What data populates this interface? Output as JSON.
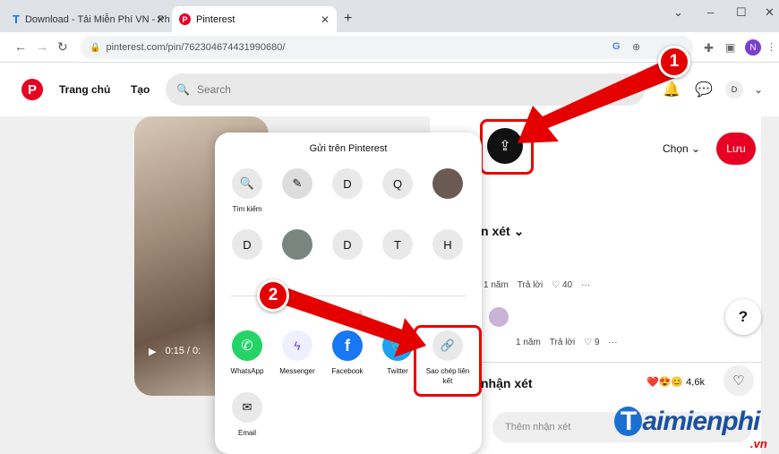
{
  "browser": {
    "tabs": [
      {
        "label": "Download - Tải Miễn Phí VN - Ph"
      },
      {
        "label": "Pinterest"
      }
    ],
    "url": "pinterest.com/pin/762304674431990680/",
    "profile_initial": "N"
  },
  "header": {
    "nav_home": "Trang chủ",
    "nav_create": "Tạo",
    "search_placeholder": "Search",
    "avatar": "D"
  },
  "pin": {
    "video_time": "0:15 / 0:"
  },
  "panel": {
    "select_label": "Chọn",
    "save_label": "Lưu",
    "comments_header": "n xét",
    "comment1_meta": {
      "time": "1 năm",
      "reply": "Trả lời",
      "likes": "40"
    },
    "comment2_meta": {
      "time": "1 năm",
      "reply": "Trả lời",
      "likes": "9"
    },
    "bottom_label": "nhận xét",
    "reactions_count": "4,6k",
    "comment_placeholder": "Thêm nhận xét"
  },
  "share_modal": {
    "title": "Gửi trên Pinterest",
    "search_label": "Tìm kiếm",
    "contacts_row1": [
      "D",
      "Q"
    ],
    "contacts_row2": [
      "D",
      "D",
      "T",
      "H"
    ],
    "apps": [
      {
        "label": "WhatsApp",
        "color": "#25d366"
      },
      {
        "label": "Messenger",
        "color": "#eef0ff"
      },
      {
        "label": "Facebook",
        "color": "#1877f2"
      },
      {
        "label": "Twitter",
        "color": "#1da1f2"
      }
    ],
    "copy_link_label": "Sao chép liên kết",
    "email_label": "Email",
    "hidden_section_fragment": "ế"
  },
  "annotations": {
    "badge1": "1",
    "badge2": "2",
    "accent": "#e00000"
  },
  "watermark": {
    "main": "aimienphi",
    "t": "T",
    "suffix": ".vn"
  }
}
